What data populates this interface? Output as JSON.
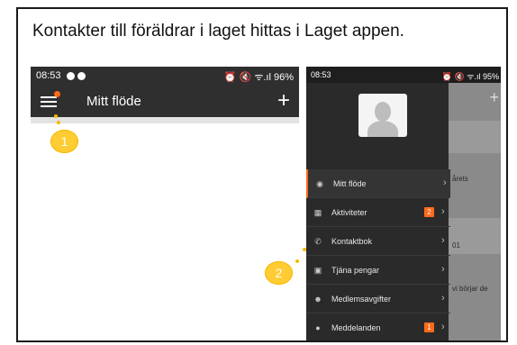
{
  "slide": {
    "title": "Kontakter till föräldrar i laget hittas i Laget appen."
  },
  "phone_left": {
    "status_time": "08:53",
    "status_right": "⏰ 🔇 ᯤ.ıl 96%",
    "app_title": "Mitt flöde",
    "plus": "+"
  },
  "phone_right": {
    "status_time": "08:53",
    "status_right": "⏰ 🔇 ᯤ.ıl 95%",
    "plus": "+",
    "bg_snippets": [
      "årets",
      "01",
      "vi börjar de"
    ],
    "menu": [
      {
        "label": "Mitt flöde",
        "icon": "eye-icon",
        "badge": "",
        "chevron": "›"
      },
      {
        "label": "Aktiviteter",
        "icon": "calendar-icon",
        "badge": "2",
        "chevron": "›"
      },
      {
        "label": "Kontaktbok",
        "icon": "phone-icon",
        "badge": "",
        "chevron": "›"
      },
      {
        "label": "Tjäna pengar",
        "icon": "money-icon",
        "badge": "",
        "chevron": "›"
      },
      {
        "label": "Medlemsavgifter",
        "icon": "people-icon",
        "badge": "",
        "chevron": "›"
      },
      {
        "label": "Meddelanden",
        "icon": "chat-icon",
        "badge": "1",
        "chevron": "›"
      }
    ]
  },
  "markers": [
    "1",
    "2"
  ],
  "colors": {
    "accent": "#ff6a1a",
    "marker": "#ffcc33",
    "appbar": "#2f2f2f",
    "drawer": "#2a2a2a"
  }
}
